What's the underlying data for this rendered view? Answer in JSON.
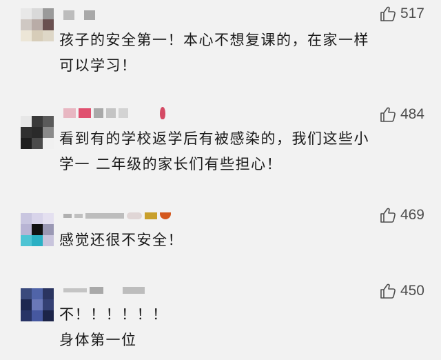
{
  "comments": [
    {
      "likes": "517",
      "lines": [
        "孩子的安全第一！本心不想复课的，在家一样",
        "可以学习！"
      ]
    },
    {
      "likes": "484",
      "lines": [
        "看到有的学校返学后有被感染的，我们这些小",
        "学一  二年级的家长们有些担心！"
      ]
    },
    {
      "likes": "469",
      "lines": [
        "感觉还很不安全！"
      ]
    },
    {
      "likes": "450",
      "lines": [
        "不！！！！！！",
        "身体第一位"
      ]
    }
  ],
  "icons": {
    "like": "thumbs-up-outline-icon"
  },
  "colors": {
    "background": "#f2f2f2",
    "text": "#1a1a1a",
    "like_icon": "#4d4d4d"
  }
}
